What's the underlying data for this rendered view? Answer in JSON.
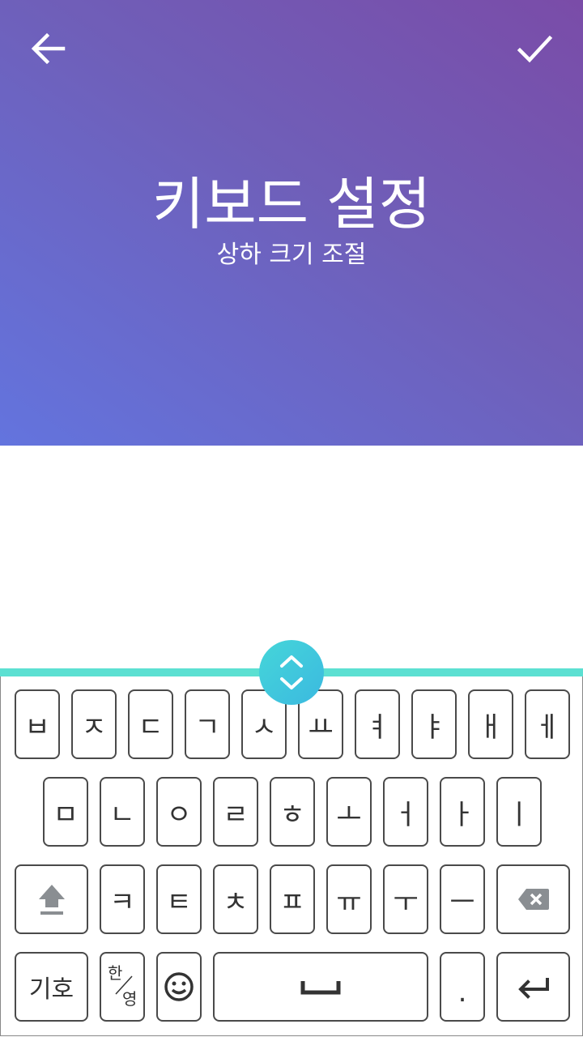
{
  "header": {
    "title": "키보드 설정",
    "subtitle": "상하 크기 조절",
    "gradient_colors": [
      "#7a4ca8",
      "#6f5fb9",
      "#6374de"
    ]
  },
  "accent_color": "#5ce0d2",
  "keyboard": {
    "row1": [
      "ㅂ",
      "ㅈ",
      "ㄷ",
      "ㄱ",
      "ㅅ",
      "ㅛ",
      "ㅕ",
      "ㅑ",
      "ㅐ",
      "ㅔ"
    ],
    "row2": [
      "ㅁ",
      "ㄴ",
      "ㅇ",
      "ㄹ",
      "ㅎ",
      "ㅗ",
      "ㅓ",
      "ㅏ",
      "ㅣ"
    ],
    "row3": [
      "ㅋ",
      "ㅌ",
      "ㅊ",
      "ㅍ",
      "ㅠ",
      "ㅜ",
      "ㅡ"
    ],
    "symbol_label": "기호",
    "hanyoung_top": "한",
    "hanyoung_bottom": "영",
    "period_label": "."
  },
  "icons": {
    "back": "arrow-left-icon",
    "confirm": "checkmark-icon",
    "resize": "chevron-up-down-icon",
    "shift": "shift-arrow-icon",
    "backspace": "backspace-icon",
    "emoji": "smiley-icon",
    "space": "space-bracket-icon",
    "enter": "return-arrow-icon"
  }
}
